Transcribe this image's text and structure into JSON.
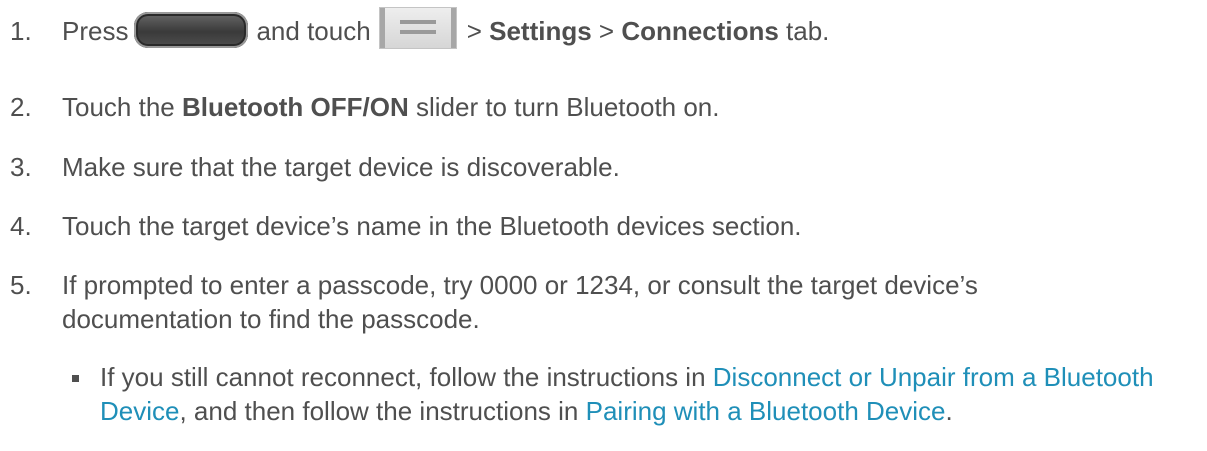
{
  "steps": [
    {
      "number": "1.",
      "press": "Press",
      "and_touch": "and touch",
      "sep1": ">",
      "settings": "Settings",
      "sep2": ">",
      "connections": "Connections",
      "tab": "tab.",
      "home_key_icon": "home-key-icon",
      "menu_key_icon": "menu-key-icon"
    },
    {
      "number": "2.",
      "pre": "Touch the",
      "bold": "Bluetooth OFF/ON",
      "post": "slider to turn Bluetooth on."
    },
    {
      "number": "3.",
      "text": "Make sure that the target device is discoverable."
    },
    {
      "number": "4.",
      "text": "Touch the target device’s name in the Bluetooth devices section."
    },
    {
      "number": "5.",
      "line1": "If prompted to enter a passcode, try 0000 or 1234, or consult the target device’s",
      "line2": "documentation to find the passcode."
    }
  ],
  "bullet": {
    "pre": "If you still cannot reconnect, follow the instructions in",
    "link1": "Disconnect or Unpair from a Bluetooth Device",
    "mid": ", and then follow the instructions in",
    "link2": "Pairing with a Bluetooth Device",
    "end": "."
  },
  "colors": {
    "text": "#4f4f4f",
    "link": "#1f8fb8"
  }
}
